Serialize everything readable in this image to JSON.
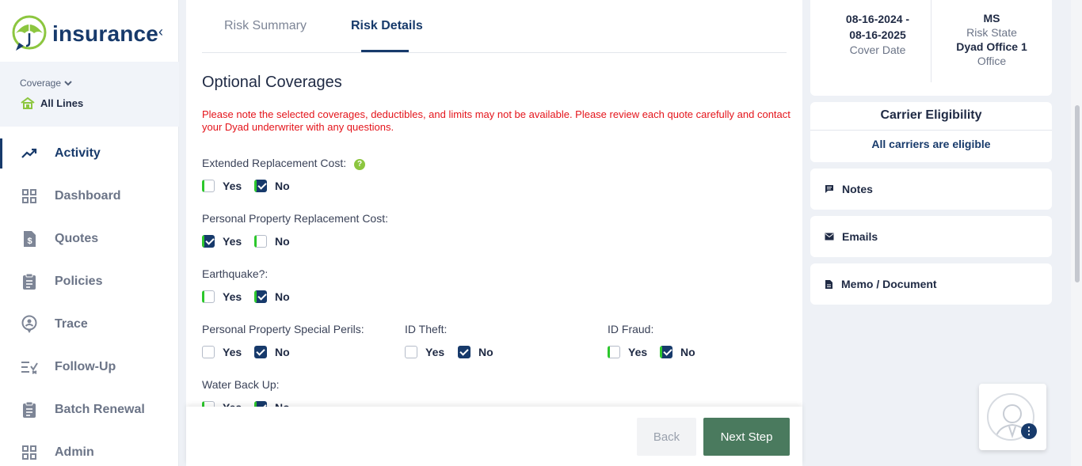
{
  "brand": {
    "name": "insurance"
  },
  "sidebar": {
    "coverage_label": "Coverage",
    "coverage_value": "All Lines",
    "items": [
      {
        "label": "Activity",
        "icon": "trending-up-icon",
        "active": true
      },
      {
        "label": "Dashboard",
        "icon": "grid-icon"
      },
      {
        "label": "Quotes",
        "icon": "dollar-doc-icon"
      },
      {
        "label": "Policies",
        "icon": "clipboard-icon"
      },
      {
        "label": "Trace",
        "icon": "location-person-icon"
      },
      {
        "label": "Follow-Up",
        "icon": "checklist-icon"
      },
      {
        "label": "Batch Renewal",
        "icon": "clipboard-icon"
      },
      {
        "label": "Admin",
        "icon": "grid-icon"
      }
    ]
  },
  "tabs": {
    "summary": "Risk Summary",
    "details": "Risk Details"
  },
  "section": {
    "title": "Optional Coverages",
    "notice": "Please note the selected coverages, deductibles, and limits may not be available. Please review each quote carefully and contact your Dyad underwriter with any questions."
  },
  "questions": {
    "extended_replacement": "Extended Replacement Cost:",
    "personal_property_replacement": "Personal Property Replacement Cost:",
    "earthquake": "Earthquake?:",
    "special_perils": "Personal Property Special Perils:",
    "id_theft": "ID Theft:",
    "id_fraud": "ID Fraud:",
    "water_backup": "Water Back Up:"
  },
  "options": {
    "yes": "Yes",
    "no": "No"
  },
  "answers": {
    "extended_replacement": "No",
    "personal_property_replacement": "Yes",
    "earthquake": "No",
    "special_perils": "No",
    "id_theft": "No",
    "id_fraud": "No",
    "water_backup": "No"
  },
  "footer": {
    "back": "Back",
    "next": "Next Step"
  },
  "info": {
    "date_from": "08-16-2024 -",
    "date_to": "08-16-2025",
    "date_label": "Cover Date",
    "state": "MS",
    "state_label": "Risk State",
    "office": "Dyad Office 1",
    "office_label": "Office"
  },
  "carrier": {
    "title": "Carrier Eligibility",
    "text": "All carriers are eligible"
  },
  "side_buttons": {
    "notes": "Notes",
    "emails": "Emails",
    "memo": "Memo / Document"
  },
  "colors": {
    "primary": "#173a6b",
    "accent_green": "#8cc63f",
    "next_button": "#4a7a5e",
    "notice": "#e4141b"
  }
}
